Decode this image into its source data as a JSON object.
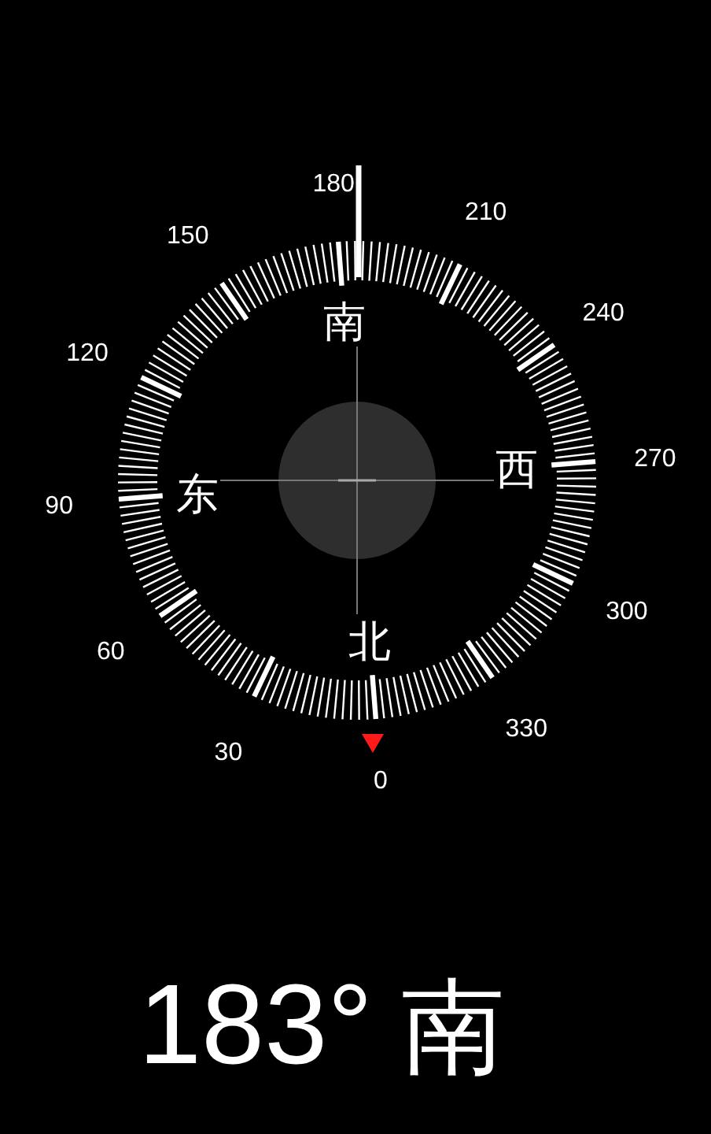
{
  "dial": {
    "degree_labels": [
      "0",
      "30",
      "60",
      "90",
      "120",
      "150",
      "180",
      "210",
      "240",
      "270",
      "300",
      "330"
    ],
    "cardinal_labels": [
      "北",
      "东",
      "南",
      "西"
    ]
  },
  "heading": {
    "degrees": "183°",
    "direction": "南"
  }
}
